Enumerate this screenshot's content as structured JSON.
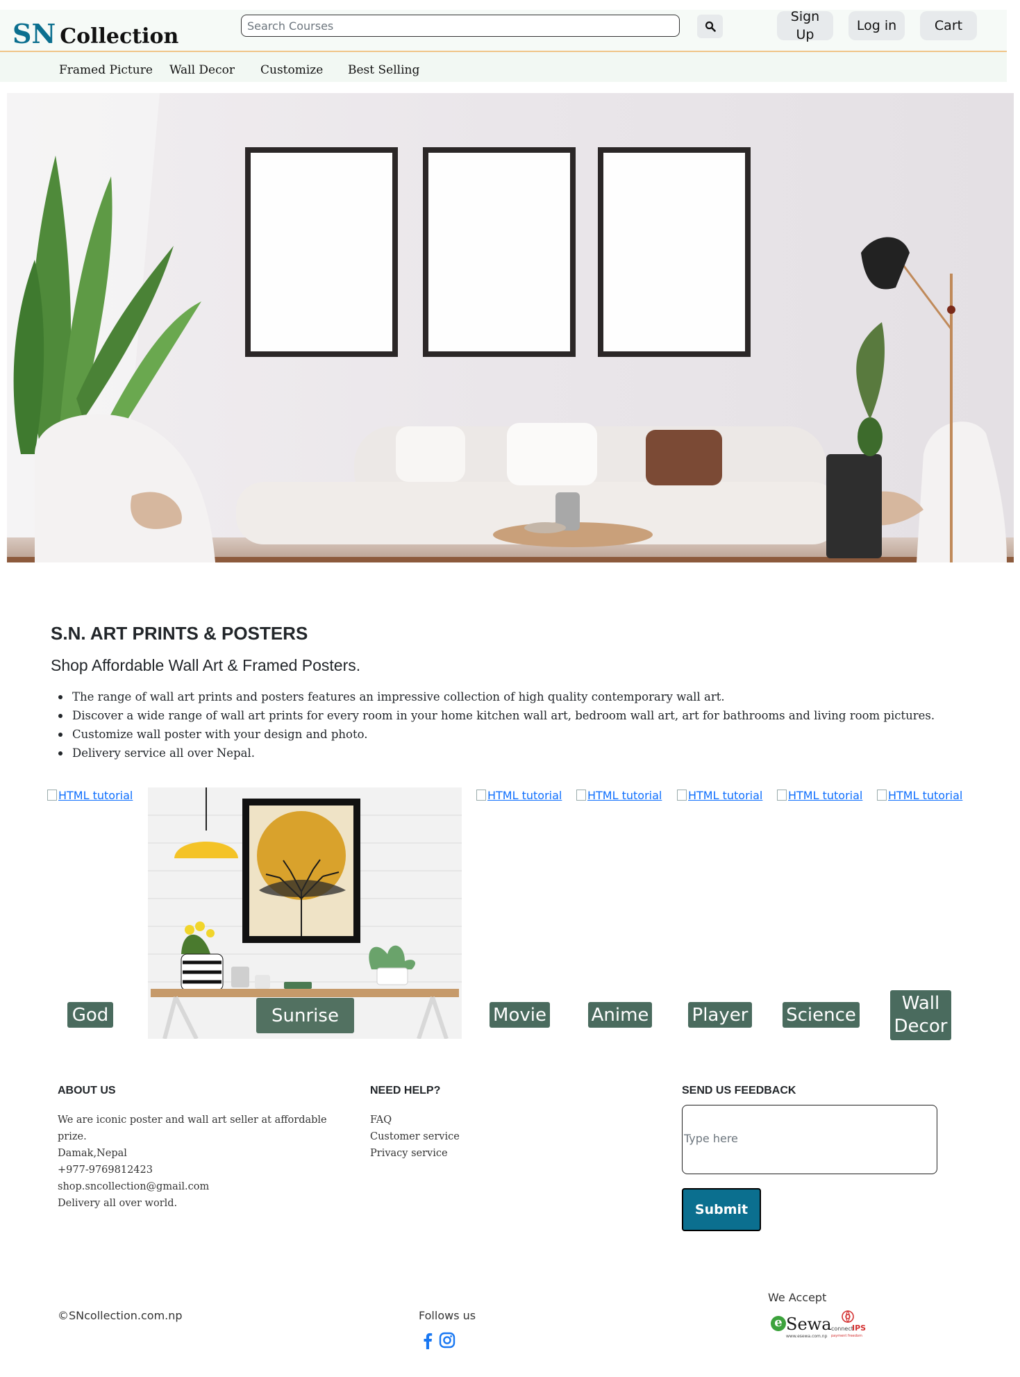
{
  "header": {
    "logo_sn": "SN",
    "logo_collection": "Collection",
    "search_placeholder": "Search Courses",
    "signup_line1": "Sign",
    "signup_line2": "Up",
    "login_label": "Log in",
    "cart_label": "Cart"
  },
  "nav": {
    "items": [
      "Framed Picture",
      "Wall Decor",
      "Customize",
      "Best Selling"
    ]
  },
  "intro": {
    "title": "S.N. ART PRINTS & POSTERS",
    "subtitle": "Shop Affordable Wall Art & Framed Posters.",
    "bullets": [
      "The range of wall art prints and posters features an impressive collection of high quality contemporary wall art.",
      "Discover a wide range of wall art prints for every room in your home kitchen wall art, bedroom wall art, art for bathrooms and living room pictures.",
      "Customize wall poster with your design and photo.",
      "Delivery service all over Nepal."
    ]
  },
  "gallery": {
    "broken_alt": "HTML tutorial",
    "captions": [
      "God",
      "Sunrise",
      "Movie",
      "Anime",
      "Player",
      "Science",
      "Wall Decor"
    ]
  },
  "footer": {
    "about": {
      "heading": "ABOUT US",
      "lines": [
        "We are iconic poster and wall art seller at affordable",
        "prize.",
        "Damak,Nepal",
        "+977-9769812423",
        "shop.sncollection@gmail.com",
        "Delivery all over world."
      ]
    },
    "help": {
      "heading": "NEED HELP?",
      "links": [
        "FAQ",
        "Customer service",
        "Privacy service"
      ]
    },
    "feedback": {
      "heading": "SEND US FEEDBACK",
      "placeholder": "Type here",
      "submit_label": "Submit"
    },
    "copyright": "©SNcollection.com.np",
    "follow_label": "Follows us",
    "accept_label": "We Accept",
    "payment_logos": {
      "esewa_e": "e",
      "esewa_text": "Sewa",
      "esewa_url": "www.esewa.com.np",
      "ips_connect": "connect",
      "ips_ips": "IPS",
      "ips_tagline": "payment freedom"
    },
    "social_icons": [
      "facebook-icon",
      "instagram-icon"
    ]
  },
  "colors": {
    "brand_blue": "#0b6f8f",
    "caption_green": "#4a6b5e",
    "link_blue": "#0d6efd",
    "header_bg": "#f6faf7",
    "header_border": "#f0c487"
  }
}
